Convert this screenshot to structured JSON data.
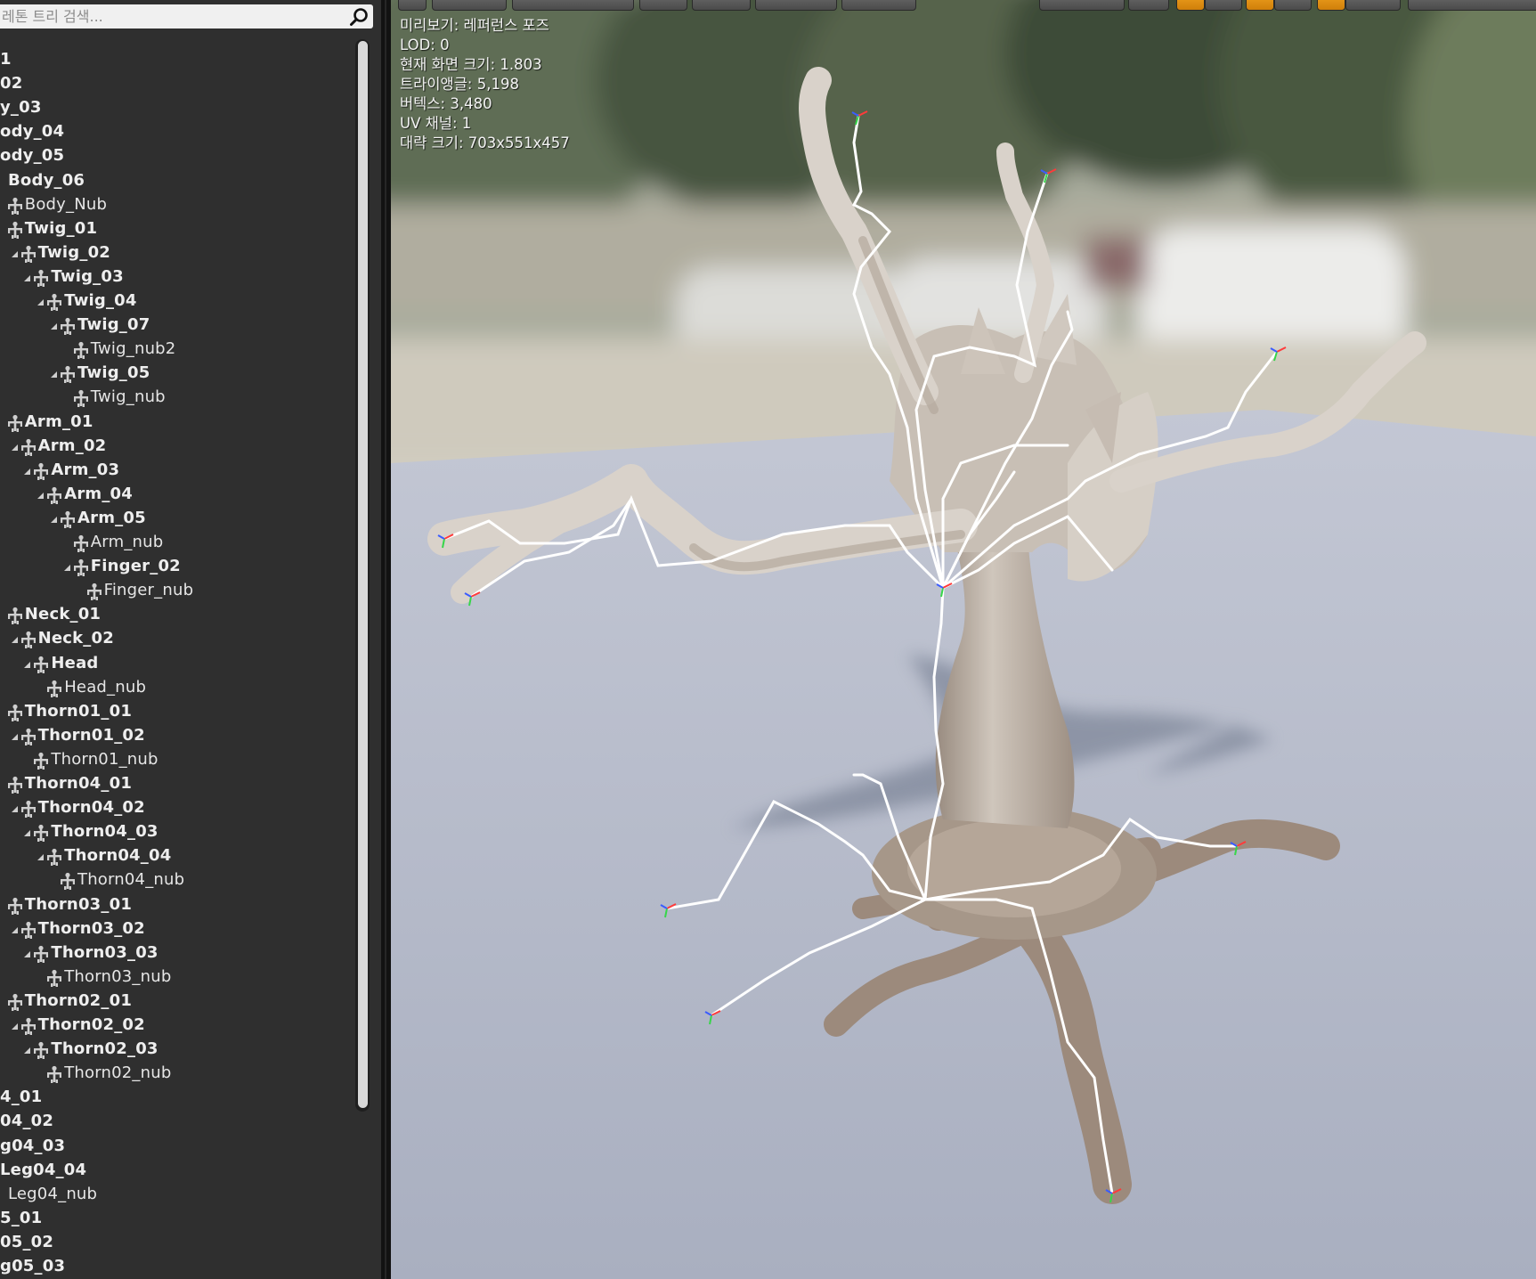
{
  "skeleton_tree": {
    "search_placeholder": "레톤 트리 검색...",
    "bones": [
      {
        "label": "1",
        "depth": 0,
        "expandable": false,
        "icon": false,
        "leaf": false
      },
      {
        "label": "02",
        "depth": 0,
        "expandable": false,
        "icon": false,
        "leaf": false
      },
      {
        "label": "y_03",
        "depth": 0,
        "expandable": false,
        "icon": false,
        "leaf": false
      },
      {
        "label": "ody_04",
        "depth": 0,
        "expandable": false,
        "icon": false,
        "leaf": false
      },
      {
        "label": "ody_05",
        "depth": 0,
        "expandable": false,
        "icon": false,
        "leaf": false
      },
      {
        "label": "Body_06",
        "depth": 0,
        "expandable": true,
        "icon": false,
        "leaf": false
      },
      {
        "label": "Body_Nub",
        "depth": 1,
        "expandable": false,
        "icon": true,
        "leaf": true
      },
      {
        "label": "Twig_01",
        "depth": 1,
        "expandable": false,
        "icon": true,
        "leaf": false
      },
      {
        "label": "Twig_02",
        "depth": 2,
        "expandable": true,
        "icon": true,
        "leaf": false
      },
      {
        "label": "Twig_03",
        "depth": 3,
        "expandable": true,
        "icon": true,
        "leaf": false
      },
      {
        "label": "Twig_04",
        "depth": 4,
        "expandable": true,
        "icon": true,
        "leaf": false
      },
      {
        "label": "Twig_07",
        "depth": 5,
        "expandable": true,
        "icon": true,
        "leaf": false
      },
      {
        "label": "Twig_nub2",
        "depth": 6,
        "expandable": false,
        "icon": true,
        "leaf": true
      },
      {
        "label": "Twig_05",
        "depth": 5,
        "expandable": true,
        "icon": true,
        "leaf": false
      },
      {
        "label": "Twig_nub",
        "depth": 6,
        "expandable": false,
        "icon": true,
        "leaf": true
      },
      {
        "label": "Arm_01",
        "depth": 1,
        "expandable": false,
        "icon": true,
        "leaf": false
      },
      {
        "label": "Arm_02",
        "depth": 2,
        "expandable": true,
        "icon": true,
        "leaf": false
      },
      {
        "label": "Arm_03",
        "depth": 3,
        "expandable": true,
        "icon": true,
        "leaf": false
      },
      {
        "label": "Arm_04",
        "depth": 4,
        "expandable": true,
        "icon": true,
        "leaf": false
      },
      {
        "label": "Arm_05",
        "depth": 5,
        "expandable": true,
        "icon": true,
        "leaf": false
      },
      {
        "label": "Arm_nub",
        "depth": 6,
        "expandable": false,
        "icon": true,
        "leaf": true
      },
      {
        "label": "Finger_02",
        "depth": 6,
        "expandable": true,
        "icon": true,
        "leaf": false
      },
      {
        "label": "Finger_nub",
        "depth": 7,
        "expandable": false,
        "icon": true,
        "leaf": true
      },
      {
        "label": "Neck_01",
        "depth": 1,
        "expandable": false,
        "icon": true,
        "leaf": false
      },
      {
        "label": "Neck_02",
        "depth": 2,
        "expandable": true,
        "icon": true,
        "leaf": false
      },
      {
        "label": "Head",
        "depth": 3,
        "expandable": true,
        "icon": true,
        "leaf": false
      },
      {
        "label": "Head_nub",
        "depth": 4,
        "expandable": false,
        "icon": true,
        "leaf": true
      },
      {
        "label": "Thorn01_01",
        "depth": 1,
        "expandable": false,
        "icon": true,
        "leaf": false
      },
      {
        "label": "Thorn01_02",
        "depth": 2,
        "expandable": true,
        "icon": true,
        "leaf": false
      },
      {
        "label": "Thorn01_nub",
        "depth": 3,
        "expandable": false,
        "icon": true,
        "leaf": true
      },
      {
        "label": "Thorn04_01",
        "depth": 1,
        "expandable": false,
        "icon": true,
        "leaf": false
      },
      {
        "label": "Thorn04_02",
        "depth": 2,
        "expandable": true,
        "icon": true,
        "leaf": false
      },
      {
        "label": "Thorn04_03",
        "depth": 3,
        "expandable": true,
        "icon": true,
        "leaf": false
      },
      {
        "label": "Thorn04_04",
        "depth": 4,
        "expandable": true,
        "icon": true,
        "leaf": false
      },
      {
        "label": "Thorn04_nub",
        "depth": 5,
        "expandable": false,
        "icon": true,
        "leaf": true
      },
      {
        "label": "Thorn03_01",
        "depth": 1,
        "expandable": false,
        "icon": true,
        "leaf": false
      },
      {
        "label": "Thorn03_02",
        "depth": 2,
        "expandable": true,
        "icon": true,
        "leaf": false
      },
      {
        "label": "Thorn03_03",
        "depth": 3,
        "expandable": true,
        "icon": true,
        "leaf": false
      },
      {
        "label": "Thorn03_nub",
        "depth": 4,
        "expandable": false,
        "icon": true,
        "leaf": true
      },
      {
        "label": "Thorn02_01",
        "depth": 1,
        "expandable": false,
        "icon": true,
        "leaf": false
      },
      {
        "label": "Thorn02_02",
        "depth": 2,
        "expandable": true,
        "icon": true,
        "leaf": false
      },
      {
        "label": "Thorn02_03",
        "depth": 3,
        "expandable": true,
        "icon": true,
        "leaf": false
      },
      {
        "label": "Thorn02_nub",
        "depth": 4,
        "expandable": false,
        "icon": true,
        "leaf": true
      },
      {
        "label": "4_01",
        "depth": 0,
        "expandable": false,
        "icon": false,
        "leaf": false
      },
      {
        "label": "04_02",
        "depth": 0,
        "expandable": false,
        "icon": false,
        "leaf": false
      },
      {
        "label": "g04_03",
        "depth": 0,
        "expandable": false,
        "icon": false,
        "leaf": false
      },
      {
        "label": "Leg04_04",
        "depth": 0,
        "expandable": false,
        "icon": false,
        "leaf": false
      },
      {
        "label": "Leg04_nub",
        "depth": 0,
        "expandable": true,
        "icon": false,
        "leaf": true
      },
      {
        "label": "5_01",
        "depth": 0,
        "expandable": false,
        "icon": false,
        "leaf": false
      },
      {
        "label": "05_02",
        "depth": 0,
        "expandable": false,
        "icon": false,
        "leaf": false
      },
      {
        "label": "g05_03",
        "depth": 0,
        "expandable": false,
        "icon": false,
        "leaf": false
      }
    ]
  },
  "viewport": {
    "stats": {
      "preview": "미리보기: 레퍼런스 포즈",
      "lod": "LOD: 0",
      "screen_size": "현재 화면 크기: 1.803",
      "triangles": "트라이앵글: 5,198",
      "vertices": "버텍스: 3,480",
      "uv_channels": "UV 채널: 1",
      "approx_size": "대략 크기: 703x551x457"
    }
  },
  "colors": {
    "panel_bg": "#2f2f2f",
    "accent_orange": "#e8950f",
    "floor": "#b7bcca",
    "bone_line": "#ffffff"
  },
  "icons": [
    "search-icon",
    "bone-icon",
    "expand-arrow-icon"
  ]
}
